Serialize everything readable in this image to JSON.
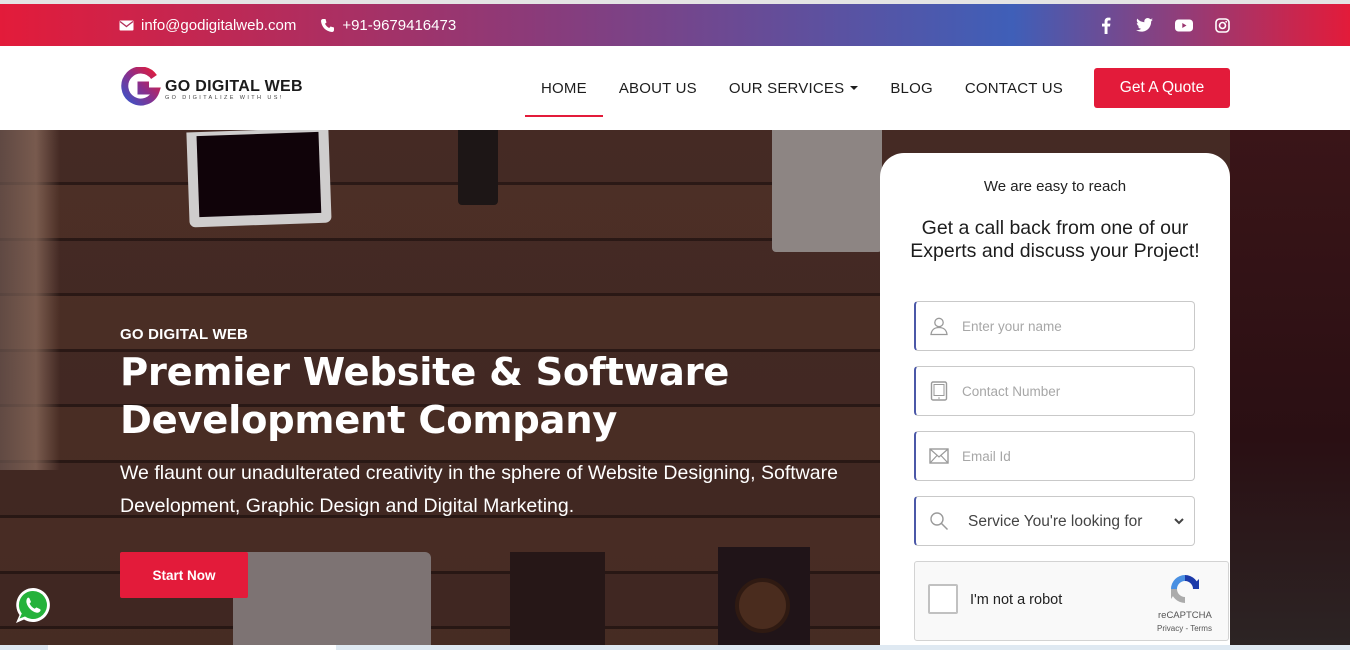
{
  "topbar": {
    "email": "info@godigitalweb.com",
    "phone": "+91-9679416473",
    "email_icon": "envelope-icon",
    "phone_icon": "phone-icon",
    "social": [
      "facebook-icon",
      "twitter-icon",
      "youtube-icon",
      "instagram-icon"
    ]
  },
  "header": {
    "logo": {
      "name": "GO DIGITAL WEB",
      "tagline": "GO DIGITALIZE WITH US!"
    },
    "nav": [
      {
        "label": "HOME",
        "active": true
      },
      {
        "label": "ABOUT US"
      },
      {
        "label": "OUR SERVICES",
        "dropdown": true
      },
      {
        "label": "BLOG"
      },
      {
        "label": "CONTACT US"
      }
    ],
    "quote_label": "Get A Quote"
  },
  "hero": {
    "kicker": "GO DIGITAL WEB",
    "title_line1": "Premier Website & Software",
    "title_line2": "Development Company",
    "description": "We flaunt our unadulterated creativity in the sphere of Website Designing, Software Development, Graphic Design and Digital Marketing.",
    "cta_label": "Start Now"
  },
  "form": {
    "subtitle": "We are easy to reach",
    "headline": "Get a call back from one of our Experts and discuss your Project!",
    "name_placeholder": "Enter your name",
    "contact_placeholder": "Contact Number",
    "email_placeholder": "Email Id",
    "service_selected": "Service You're looking for",
    "captcha": {
      "label": "I'm not a robot",
      "brand": "reCAPTCHA",
      "links": "Privacy - Terms"
    }
  },
  "colors": {
    "accent": "#e31b3a",
    "field_border_accent": "#4b58a8",
    "whatsapp": "#25b23b"
  }
}
